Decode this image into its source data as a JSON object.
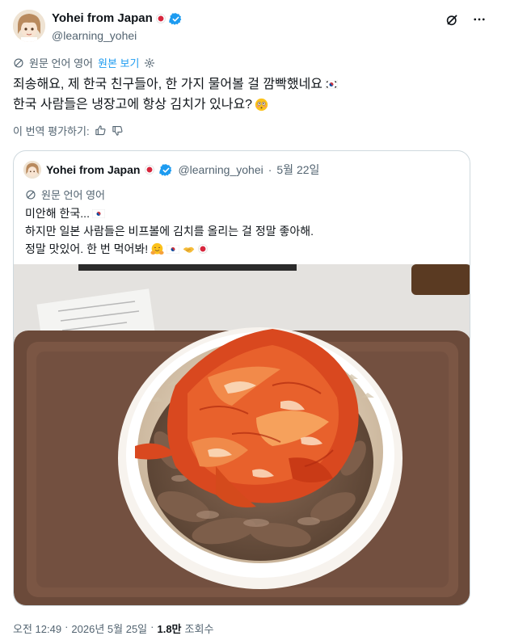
{
  "author": {
    "display_name": "Yohei from Japan",
    "handle": "@learning_yohei"
  },
  "translate_bar": {
    "source_language": "원문 언어 영어",
    "show_original": "원본 보기"
  },
  "tweet": {
    "line1": "죄송해요, 제 한국 친구들아, 한 가지 물어볼 걸 깜빡했네요",
    "line2": "한국 사람들은 냉장고에 항상 김치가 있나요?"
  },
  "rate_translation": "이 번역 평가하기:",
  "quoted": {
    "display_name": "Yohei from Japan",
    "handle": "@learning_yohei",
    "separator": "·",
    "date": "5월 22일",
    "source_language": "원문 언어 영어",
    "line1": "미안해 한국...",
    "line2": "하지만 일본 사람들은 비프볼에 김치를 올리는 걸 정말 좋아해.",
    "line3": "정말 맛있어. 한 번 먹어봐!"
  },
  "footer": {
    "time": "오전 12:49",
    "sep1": "·",
    "date": "2026년 5월 25일",
    "sep2": "·",
    "views": "1.8만",
    "views_label": "조회수"
  },
  "icons": [
    "verified-badge-icon",
    "grok-icon",
    "more-icon",
    "translate-icon",
    "settings-gear-icon",
    "thumbs-up-icon",
    "thumbs-down-icon",
    "japan-flag-icon",
    "korea-flag-icon",
    "flushed-face-icon",
    "hugging-face-icon",
    "handshake-icon"
  ],
  "colors": {
    "accent": "#1d9bf0",
    "secondary_text": "#536471",
    "border": "#cfd9de"
  }
}
